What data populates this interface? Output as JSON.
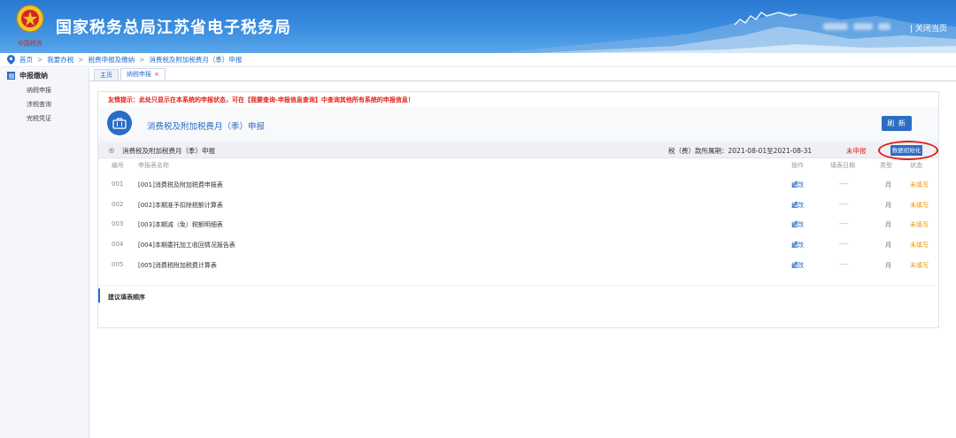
{
  "header": {
    "site_title": "国家税务总局江苏省电子税务局",
    "close_link": "| 关闭当页"
  },
  "breadcrumb": {
    "items": [
      "首页",
      "我要办税",
      "税费申报及缴纳",
      "消费税及附加税费月（季）申报"
    ],
    "separator": ">"
  },
  "sidebar": {
    "section": "申报缴纳",
    "items": [
      "纳税申报",
      "涉税查询",
      "完税凭证"
    ]
  },
  "tabs": [
    {
      "label": "主页",
      "closable": false
    },
    {
      "label": "纳税申报",
      "closable": true,
      "close_glyph": "×"
    }
  ],
  "main": {
    "notice": "友情提示：此处只显示在本系统的申报状态，可在【我要查询-申报信息查询】中查询其他所有系统的申报信息！",
    "page_title": "消费税及附加税费月（季）申报",
    "refresh_label": "刷 新",
    "declaration": {
      "name": "消费税及附加税费月（季）申报",
      "period": "税（费）款所属期：2021-08-01至2021-08-31",
      "status": "未申报",
      "init_button": "数据初始化"
    },
    "columns": [
      "编号",
      "申报表名称",
      "操作",
      "填表日期",
      "类型",
      "状态"
    ],
    "rows": [
      {
        "no": "001",
        "name": "[001]消费税及附加税费申报表",
        "action": "修改",
        "date": "----",
        "type": "月",
        "state": "未填写"
      },
      {
        "no": "002",
        "name": "[002]本期准予扣除税额计算表",
        "action": "修改",
        "date": "----",
        "type": "月",
        "state": "未填写"
      },
      {
        "no": "003",
        "name": "[003]本期减（免）税额明细表",
        "action": "修改",
        "date": "----",
        "type": "月",
        "state": "未填写"
      },
      {
        "no": "004",
        "name": "[004]本期委托加工收回情况报告表",
        "action": "修改",
        "date": "----",
        "type": "月",
        "state": "未填写"
      },
      {
        "no": "005",
        "name": "[005]消费税附加税费计算表",
        "action": "修改",
        "date": "----",
        "type": "月",
        "state": "未填写"
      }
    ],
    "order_label": "建议填表顺序"
  },
  "colors": {
    "primary": "#2b6cc4",
    "alert": "#e0201a",
    "pending": "#f39800"
  }
}
